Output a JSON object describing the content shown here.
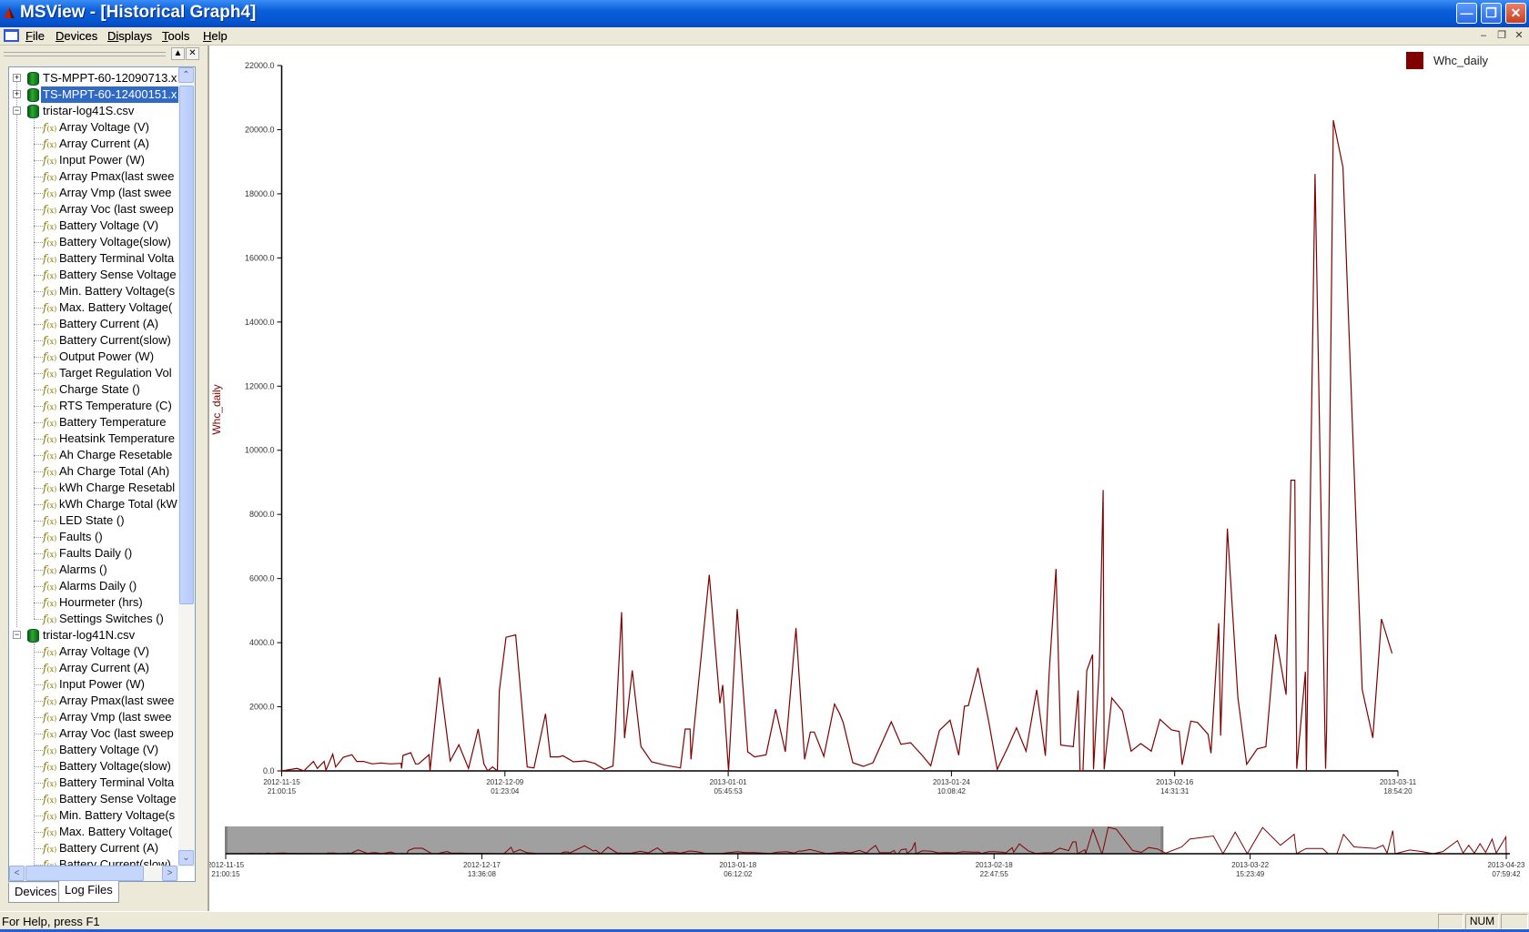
{
  "window": {
    "title": "MSView - [Historical Graph4]"
  },
  "menu": [
    {
      "label": "File",
      "u": "F",
      "rest": "ile"
    },
    {
      "label": "Devices",
      "u": "D",
      "rest": "evices"
    },
    {
      "label": "Displays",
      "u": "Di",
      "rest": "splays"
    },
    {
      "label": "Tools",
      "u": "T",
      "rest": "ools"
    },
    {
      "label": "Help",
      "u": "H",
      "rest": "elp"
    }
  ],
  "tree": {
    "devices": [
      {
        "label": "TS-MPPT-60-12090713.x",
        "expanded": false,
        "selected": false
      },
      {
        "label": "TS-MPPT-60-12400151.x",
        "expanded": false,
        "selected": true
      },
      {
        "label": "tristar-log41S.csv",
        "expanded": true,
        "selected": false
      },
      {
        "label": "tristar-log41N.csv",
        "expanded": true,
        "selected": false
      }
    ],
    "channels": [
      "Array Voltage (V)",
      "Array Current (A)",
      "Input Power (W)",
      "Array Pmax(last swee",
      "Array Vmp (last swee",
      "Array Voc (last sweep",
      "Battery Voltage (V)",
      "Battery Voltage(slow)",
      "Battery Terminal Volta",
      "Battery Sense Voltage",
      "Min. Battery Voltage(s",
      "Max. Battery Voltage(",
      "Battery Current (A)",
      "Battery Current(slow)",
      "Output Power (W)",
      "Target Regulation Vol",
      "Charge State ()",
      "RTS Temperature (C)",
      "Battery Temperature",
      "Heatsink Temperature",
      "Ah Charge Resetable",
      "Ah Charge Total (Ah)",
      "kWh Charge Resetabl",
      "kWh Charge Total (kW",
      "LED State ()",
      "Faults ()",
      "Faults Daily ()",
      "Alarms ()",
      "Alarms Daily ()",
      "Hourmeter (hrs)",
      "Settings Switches ()"
    ],
    "channels_second_visible": [
      "Array Voltage (V)",
      "Array Current (A)",
      "Input Power (W)",
      "Array Pmax(last swee",
      "Array Vmp (last swee",
      "Array Voc (last sweep",
      "Battery Voltage (V)",
      "Battery Voltage(slow)",
      "Battery Terminal Volta",
      "Battery Sense Voltage",
      "Min. Battery Voltage(s",
      "Max. Battery Voltage(",
      "Battery Current (A)",
      "Battery Current(slow)"
    ]
  },
  "tabs": [
    {
      "label": "Devices",
      "active": false
    },
    {
      "label": "Log Files",
      "active": true
    }
  ],
  "status": {
    "help": "For Help, press F1",
    "num": "NUM"
  },
  "chart_data": {
    "type": "line",
    "title": "",
    "ylabel": "Whc_daily",
    "xlabel": "",
    "legend": {
      "entries": [
        "Whc_daily"
      ],
      "placement": "top-right"
    },
    "color": "#800000",
    "x_unit": "days since 2012-11-15 21:00:15",
    "xlim": [
      0,
      115.91
    ],
    "ylim": [
      0,
      22000
    ],
    "yticks": [
      "0.0",
      "2000.0",
      "4000.0",
      "6000.0",
      "8000.0",
      "10000.0",
      "12000.0",
      "14000.0",
      "16000.0",
      "18000.0",
      "20000.0",
      "22000.0"
    ],
    "xticks": [
      {
        "date": "2012-11-15",
        "time": "21:00:15"
      },
      {
        "date": "2012-12-09",
        "time": "01:23:04"
      },
      {
        "date": "2013-01-01",
        "time": "05:45:53"
      },
      {
        "date": "2013-01-24",
        "time": "10:08:42"
      },
      {
        "date": "2013-02-16",
        "time": "14:31:31"
      },
      {
        "date": "2013-03-11",
        "time": "18:54:20"
      }
    ],
    "series": [
      {
        "name": "Whc_daily",
        "points": [
          [
            0,
            0
          ],
          [
            1.6,
            76
          ],
          [
            2.3,
            0
          ],
          [
            3.3,
            294
          ],
          [
            3.7,
            76
          ],
          [
            4.4,
            294
          ],
          [
            4.6,
            20
          ],
          [
            5.3,
            521
          ],
          [
            5.6,
            123
          ],
          [
            6.4,
            426
          ],
          [
            7.3,
            502
          ],
          [
            7.8,
            294
          ],
          [
            8.5,
            294
          ],
          [
            9.4,
            218
          ],
          [
            10.3,
            246
          ],
          [
            11.3,
            218
          ],
          [
            12.4,
            237
          ],
          [
            12.45,
            76
          ],
          [
            12.6,
            483
          ],
          [
            13.4,
            568
          ],
          [
            13.9,
            218
          ],
          [
            14.2,
            218
          ],
          [
            15.3,
            502
          ],
          [
            15.4,
            0
          ],
          [
            16.4,
            2917
          ],
          [
            17.5,
            313
          ],
          [
            18.4,
            814
          ],
          [
            19.4,
            76
          ],
          [
            20.4,
            1307
          ],
          [
            21.0,
            218
          ],
          [
            21.4,
            0
          ],
          [
            21.9,
            123
          ],
          [
            22.4,
            0
          ],
          [
            22.6,
            2490
          ],
          [
            23.3,
            4167
          ],
          [
            24.3,
            4243
          ],
          [
            25.5,
            123
          ],
          [
            26.2,
            95
          ],
          [
            27.4,
            1780
          ],
          [
            27.9,
            436
          ],
          [
            28.8,
            436
          ],
          [
            29.2,
            474
          ],
          [
            30.3,
            284
          ],
          [
            31.5,
            313
          ],
          [
            32.5,
            237
          ],
          [
            33.5,
            47
          ],
          [
            34.4,
            152
          ],
          [
            34.6,
            975
          ],
          [
            35.3,
            4953
          ],
          [
            35.6,
            1023
          ],
          [
            36.4,
            3135
          ],
          [
            37.3,
            767
          ],
          [
            38.4,
            284
          ],
          [
            39.8,
            180
          ],
          [
            41.4,
            95
          ],
          [
            41.9,
            1307
          ],
          [
            42.4,
            1307
          ],
          [
            42.5,
            360
          ],
          [
            44.4,
            6118
          ],
          [
            45.5,
            2112
          ],
          [
            45.8,
            2680
          ],
          [
            46.4,
            0
          ],
          [
            47.3,
            5048
          ],
          [
            48.4,
            597
          ],
          [
            49.1,
            436
          ],
          [
            50.3,
            502
          ],
          [
            51.3,
            1922
          ],
          [
            52.3,
            597
          ],
          [
            53.4,
            4451
          ],
          [
            54.3,
            360
          ],
          [
            54.9,
            1212
          ],
          [
            55.3,
            1212
          ],
          [
            56.3,
            455
          ],
          [
            57.4,
            2083
          ],
          [
            57.9,
            1809
          ],
          [
            58.3,
            1515
          ],
          [
            59.3,
            256
          ],
          [
            60.4,
            142
          ],
          [
            61.4,
            256
          ],
          [
            63.3,
            1534
          ],
          [
            64.3,
            833
          ],
          [
            65.3,
            881
          ],
          [
            66.4,
            521
          ],
          [
            67.4,
            161
          ],
          [
            68.3,
            1260
          ],
          [
            69.4,
            1582
          ],
          [
            70.3,
            492
          ],
          [
            70.9,
            2017
          ],
          [
            71.3,
            2036
          ],
          [
            72.3,
            3220
          ],
          [
            73.4,
            1563
          ],
          [
            74.3,
            47
          ],
          [
            75.4,
            729
          ],
          [
            76.3,
            1345
          ],
          [
            77.3,
            616
          ],
          [
            78.4,
            2528
          ],
          [
            79.3,
            474
          ],
          [
            79.7,
            3078
          ],
          [
            80.4,
            6298
          ],
          [
            80.9,
            805
          ],
          [
            82.2,
            758
          ],
          [
            82.7,
            2510
          ],
          [
            82.9,
            0
          ],
          [
            83.2,
            0
          ],
          [
            83.6,
            3125
          ],
          [
            84.2,
            3627
          ],
          [
            84.3,
            47
          ],
          [
            84.9,
            3267
          ],
          [
            85.3,
            8760
          ],
          [
            85.4,
            47
          ],
          [
            86.2,
            2273
          ],
          [
            87.3,
            1866
          ],
          [
            88.2,
            616
          ],
          [
            89.2,
            852
          ],
          [
            90.3,
            616
          ],
          [
            91.2,
            1610
          ],
          [
            92.4,
            1278
          ],
          [
            93.2,
            1231
          ],
          [
            93.5,
            189
          ],
          [
            94.4,
            1553
          ],
          [
            95.1,
            1511
          ],
          [
            96.2,
            1140
          ],
          [
            96.5,
            550
          ],
          [
            97.3,
            4603
          ],
          [
            97.5,
            1099
          ],
          [
            98.2,
            7557
          ],
          [
            99.3,
            2267
          ],
          [
            100.2,
            206
          ],
          [
            101.3,
            687
          ],
          [
            102.2,
            756
          ],
          [
            103.2,
            4259
          ],
          [
            104.3,
            2377
          ],
          [
            104.8,
            9068
          ],
          [
            105.2,
            9068
          ],
          [
            105.4,
            69
          ],
          [
            106.3,
            3092
          ],
          [
            106.4,
            0
          ],
          [
            107.3,
            18618
          ],
          [
            108.4,
            69
          ],
          [
            108.5,
            1237
          ],
          [
            109.2,
            20294
          ],
          [
            110.2,
            18824
          ],
          [
            112.2,
            2542
          ],
          [
            113.3,
            1030
          ],
          [
            114.2,
            4740
          ],
          [
            115.3,
            3669
          ]
        ]
      }
    ],
    "overview": {
      "xlim": [
        0,
        158.44
      ],
      "selection": [
        0,
        115.91
      ],
      "xticks": [
        {
          "date": "2012-11-15",
          "time": "21:00:15"
        },
        {
          "date": "2012-12-17",
          "time": "13:36:08"
        },
        {
          "date": "2013-01-18",
          "time": "06:12:02"
        },
        {
          "date": "2013-02-18",
          "time": "22:47:55"
        },
        {
          "date": "2013-03-22",
          "time": "15:23:49"
        },
        {
          "date": "2013-04-23",
          "time": "07:59:42"
        }
      ],
      "tail_points": [
        [
          116.3,
          500
        ],
        [
          118.3,
          5280
        ],
        [
          119.3,
          11280
        ],
        [
          122.2,
          13680
        ],
        [
          123.4,
          0
        ],
        [
          124.9,
          16560
        ],
        [
          126.4,
          0
        ],
        [
          128.3,
          20160
        ],
        [
          130.5,
          6480
        ],
        [
          132.2,
          14880
        ],
        [
          132.5,
          0
        ],
        [
          133.7,
          4080
        ],
        [
          135.7,
          4080
        ],
        [
          136.4,
          0
        ],
        [
          137.5,
          0
        ],
        [
          138.3,
          14880
        ],
        [
          139.6,
          5280
        ],
        [
          142.3,
          4080
        ],
        [
          143.2,
          6480
        ],
        [
          143.7,
          480
        ],
        [
          144.4,
          17760
        ],
        [
          144.7,
          0
        ],
        [
          146.5,
          2880
        ],
        [
          148.0,
          1680
        ],
        [
          149.4,
          0
        ],
        [
          150.6,
          1680
        ],
        [
          152.4,
          10080
        ],
        [
          153.1,
          480
        ],
        [
          153.8,
          6480
        ],
        [
          154.5,
          480
        ],
        [
          155.2,
          7680
        ],
        [
          155.9,
          960
        ],
        [
          156.7,
          11280
        ],
        [
          157.2,
          480
        ],
        [
          158.4,
          12960
        ],
        [
          158.44,
          0
        ]
      ]
    }
  }
}
